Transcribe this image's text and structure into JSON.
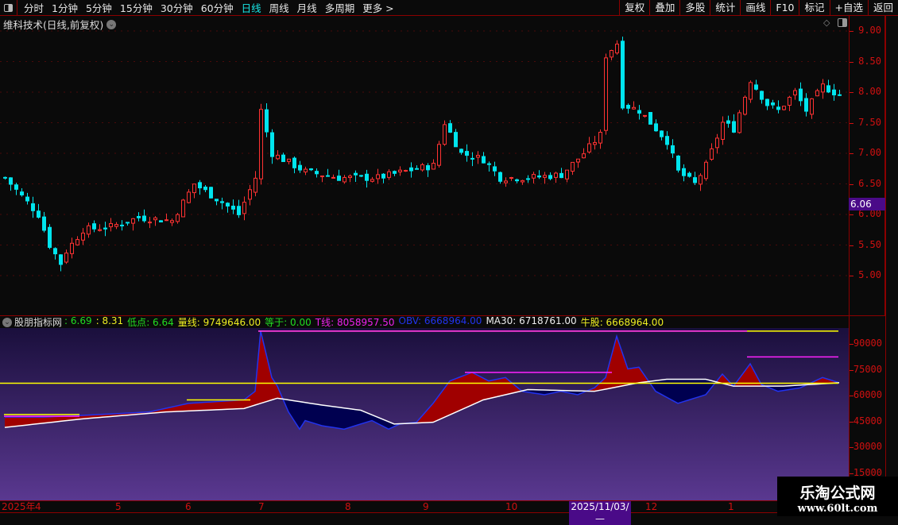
{
  "toolbar": {
    "periods": [
      "分时",
      "1分钟",
      "5分钟",
      "15分钟",
      "30分钟",
      "60分钟",
      "日线",
      "周线",
      "月线",
      "多周期",
      "更多 >"
    ],
    "active": "日线",
    "right_buttons": [
      "复权",
      "叠加",
      "多股",
      "统计",
      "画线",
      "F10",
      "标记",
      "+自选",
      "返回"
    ]
  },
  "title": "维科技术(日线,前复权)",
  "price_axis": {
    "ticks": [
      "9.00",
      "8.50",
      "8.00",
      "7.50",
      "7.00",
      "6.50",
      "6.00",
      "5.50",
      "5.00"
    ],
    "current": "6.06"
  },
  "indicator": {
    "name": "股朋指标网",
    "fields": [
      {
        "label": "",
        "value": ": 6.69",
        "color": "#22dd22"
      },
      {
        "label": "",
        "value": ": 8.31",
        "color": "#eeee22"
      },
      {
        "label": "低点",
        "value": ": 6.64",
        "color": "#22dd22"
      },
      {
        "label": "量线",
        "value": ": 9749646.00",
        "color": "#eeee22"
      },
      {
        "label": "等于",
        "value": ": 0.00",
        "color": "#22dd22"
      },
      {
        "label": "T线",
        "value": ": 8058957.50",
        "color": "#ee22ee"
      },
      {
        "label": "OBV",
        "value": ": 6668964.00",
        "color": "#2233ee"
      },
      {
        "label": "MA30",
        "value": ": 6718761.00",
        "color": "#eeeeee"
      },
      {
        "label": "牛股",
        "value": ": 6668964.00",
        "color": "#eeee22"
      }
    ],
    "axis_ticks": [
      "90000",
      "75000",
      "60000",
      "45000",
      "30000",
      "15000"
    ]
  },
  "time_axis": {
    "labels": [
      "2025年",
      "4",
      "5",
      "6",
      "7",
      "8",
      "9",
      "10",
      "12",
      "1"
    ],
    "cursor": "2025/11/03/—"
  },
  "watermark": {
    "title": "乐淘公式网",
    "url": "www.60lt.com"
  },
  "colors": {
    "up": "#ff3232",
    "down": "#00e5ee",
    "axis": "#d01010"
  },
  "chart_data": {
    "type": "candlestick",
    "price_keypoints": [
      [
        0,
        6.6
      ],
      [
        3,
        6.3
      ],
      [
        6,
        6.0
      ],
      [
        8,
        5.5
      ],
      [
        10,
        5.2
      ],
      [
        11,
        5.4
      ],
      [
        14,
        5.75
      ],
      [
        19,
        5.8
      ],
      [
        24,
        5.95
      ],
      [
        30,
        5.9
      ],
      [
        34,
        6.5
      ],
      [
        39,
        6.2
      ],
      [
        42,
        6.0
      ],
      [
        45,
        6.6
      ],
      [
        46,
        7.7
      ],
      [
        48,
        7.0
      ],
      [
        50,
        6.9
      ],
      [
        54,
        6.7
      ],
      [
        60,
        6.6
      ],
      [
        67,
        6.6
      ],
      [
        74,
        6.75
      ],
      [
        77,
        6.8
      ],
      [
        79,
        7.5
      ],
      [
        82,
        7.0
      ],
      [
        86,
        6.9
      ],
      [
        89,
        6.6
      ],
      [
        94,
        6.6
      ],
      [
        100,
        6.65
      ],
      [
        104,
        7.0
      ],
      [
        107,
        7.3
      ],
      [
        108,
        8.6
      ],
      [
        110,
        8.8
      ],
      [
        111,
        7.8
      ],
      [
        114,
        7.7
      ],
      [
        119,
        7.2
      ],
      [
        121,
        6.7
      ],
      [
        124,
        6.5
      ],
      [
        126,
        6.8
      ],
      [
        129,
        7.5
      ],
      [
        131,
        7.4
      ],
      [
        134,
        8.2
      ],
      [
        137,
        7.8
      ],
      [
        139,
        7.7
      ],
      [
        142,
        8.0
      ],
      [
        144,
        7.7
      ],
      [
        147,
        8.1
      ],
      [
        150,
        7.95
      ]
    ],
    "obv_keypoints": [
      [
        0,
        47000
      ],
      [
        7,
        47000
      ],
      [
        14,
        48000
      ],
      [
        26,
        50000
      ],
      [
        33,
        55000
      ],
      [
        43,
        57000
      ],
      [
        45,
        62000
      ],
      [
        46,
        97000
      ],
      [
        48,
        70000
      ],
      [
        49,
        65000
      ],
      [
        51,
        50000
      ],
      [
        53,
        40000
      ],
      [
        54,
        45000
      ],
      [
        57,
        42000
      ],
      [
        61,
        40000
      ],
      [
        66,
        45000
      ],
      [
        69,
        40000
      ],
      [
        71,
        43000
      ],
      [
        74,
        44000
      ],
      [
        77,
        55000
      ],
      [
        80,
        68000
      ],
      [
        84,
        73000
      ],
      [
        87,
        68000
      ],
      [
        90,
        70000
      ],
      [
        93,
        62000
      ],
      [
        97,
        60000
      ],
      [
        100,
        62000
      ],
      [
        103,
        60000
      ],
      [
        106,
        64000
      ],
      [
        108,
        70000
      ],
      [
        110,
        94000
      ],
      [
        112,
        75000
      ],
      [
        114,
        76000
      ],
      [
        117,
        62000
      ],
      [
        121,
        55000
      ],
      [
        126,
        60000
      ],
      [
        129,
        72000
      ],
      [
        131,
        65000
      ],
      [
        134,
        78000
      ],
      [
        136,
        66000
      ],
      [
        139,
        62000
      ],
      [
        143,
        64000
      ],
      [
        147,
        70000
      ],
      [
        150,
        67000
      ]
    ],
    "ma30_keypoints": [
      [
        0,
        41000
      ],
      [
        14,
        46000
      ],
      [
        29,
        50000
      ],
      [
        43,
        52000
      ],
      [
        49,
        58000
      ],
      [
        57,
        54000
      ],
      [
        64,
        51000
      ],
      [
        70,
        43000
      ],
      [
        77,
        44000
      ],
      [
        86,
        57000
      ],
      [
        94,
        63000
      ],
      [
        106,
        62000
      ],
      [
        114,
        67000
      ],
      [
        119,
        69000
      ],
      [
        126,
        69000
      ],
      [
        131,
        65000
      ],
      [
        140,
        65000
      ],
      [
        150,
        67000
      ]
    ],
    "level_line": 66690
  }
}
